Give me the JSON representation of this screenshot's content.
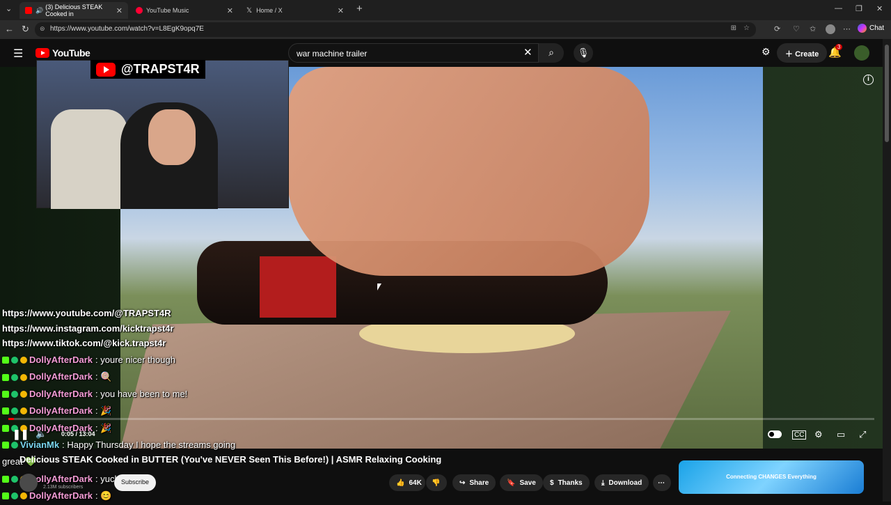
{
  "browser": {
    "tabs": [
      {
        "label": "(3) Delicious STEAK Cooked in",
        "active": true
      },
      {
        "label": "YouTube Music",
        "active": false
      },
      {
        "label": "Home / X",
        "active": false
      }
    ],
    "url": "https://www.youtube.com/watch?v=L8EgK9opq7E",
    "chat_label": "Chat"
  },
  "youtube": {
    "logo": "YouTube",
    "search_value": "war machine trailer",
    "create_label": "Create",
    "notification_count": "3"
  },
  "stream_overlay": {
    "handle": "@TRAPST4R",
    "links": [
      "https://www.youtube.com/@TRAPST4R",
      "https://www.instagram.com/kicktrapst4r",
      "https://www.tiktok.com/@kick.trapst4r"
    ],
    "chat": [
      {
        "user": "DollyAfterDark",
        "message": ": youre nicer though"
      },
      {
        "user": "DollyAfterDark",
        "message": ": 🍭"
      },
      {
        "user": "DollyAfterDark",
        "message": ": you have been to me!"
      },
      {
        "user": "DollyAfterDark",
        "message": ": 🎉"
      },
      {
        "user": "DollyAfterDark",
        "message": ": 🎉"
      },
      {
        "user": "VivianMk",
        "message": ": Happy Thursday I hope the streams going"
      },
      {
        "user": "",
        "message": "great 💚"
      },
      {
        "user": "DollyAfterDark",
        "message": ": yucky"
      },
      {
        "user": "DollyAfterDark",
        "message": ": 😊"
      }
    ]
  },
  "player": {
    "time": "0:05 / 13:04",
    "progress_fraction": 0.0064
  },
  "video": {
    "title": "Delicious STEAK Cooked in BUTTER (You've NEVER Seen This Before!) | ASMR Relaxing Cooking",
    "title_prefix_hidden": "De",
    "subscribe_label": "Subscribe",
    "subscribers": "2.13M subscribers",
    "likes": "64K",
    "share_label": "Share",
    "save_label": "Save",
    "thanks_label": "Thanks",
    "download_label": "Download"
  },
  "ad": {
    "text": "Connecting CHANGES Everything"
  },
  "colors": {
    "youtube_red": "#ff0000",
    "kick_green": "#53fc18"
  }
}
